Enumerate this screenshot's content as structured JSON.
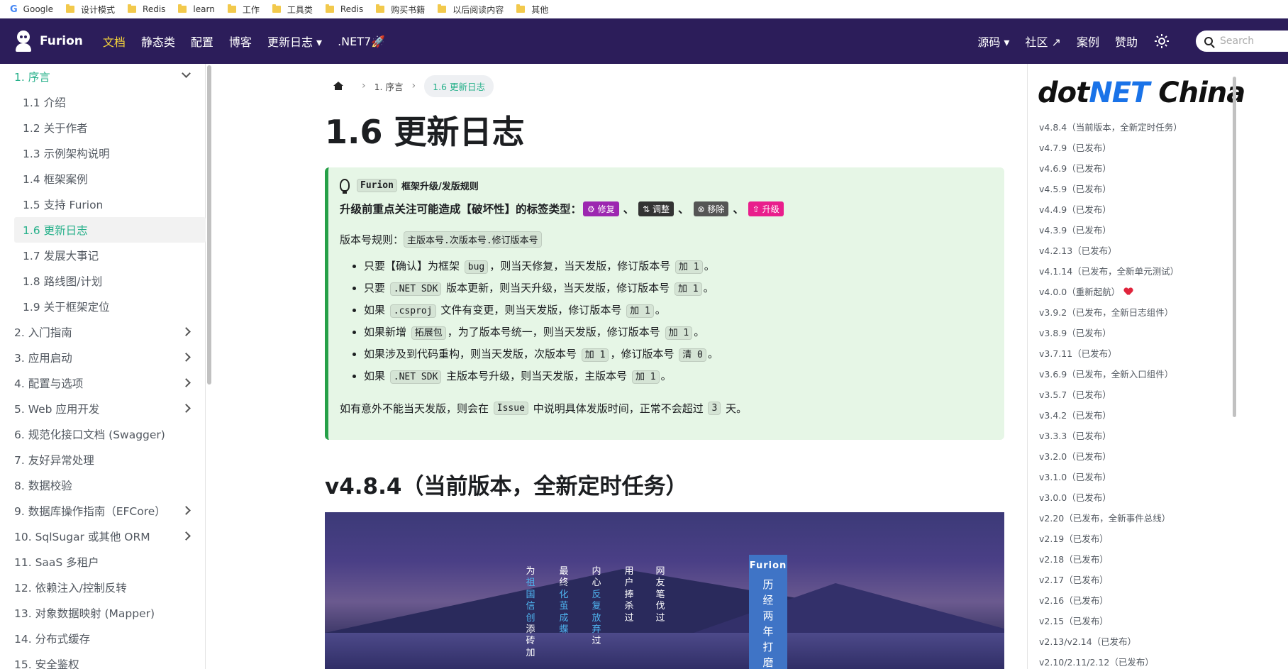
{
  "bookmarks": [
    {
      "label": "Google",
      "icon": "google-icon"
    },
    {
      "label": "设计模式",
      "icon": "folder-icon"
    },
    {
      "label": "Redis",
      "icon": "folder-icon"
    },
    {
      "label": "learn",
      "icon": "folder-icon"
    },
    {
      "label": "工作",
      "icon": "folder-icon"
    },
    {
      "label": "工具类",
      "icon": "folder-icon"
    },
    {
      "label": "Redis",
      "icon": "folder-icon"
    },
    {
      "label": "购买书籍",
      "icon": "folder-icon"
    },
    {
      "label": "以后阅读内容",
      "icon": "folder-icon"
    },
    {
      "label": "其他",
      "icon": "folder-icon"
    }
  ],
  "navbar": {
    "brand": "Furion",
    "items": [
      "文档",
      "静态类",
      "配置",
      "博客",
      "更新日志 ▾",
      ".NET7🚀"
    ],
    "active_item": "文档",
    "right_items": [
      "源码 ▾",
      "社区 ↗",
      "案例",
      "赞助"
    ],
    "search_placeholder": "Search"
  },
  "sidebar": {
    "items": [
      {
        "label": "1. 序言",
        "level": "top",
        "state": "cat-active",
        "chevron": "down"
      },
      {
        "label": "1.1 介绍",
        "level": "sub"
      },
      {
        "label": "1.2 关于作者",
        "level": "sub"
      },
      {
        "label": "1.3 示例架构说明",
        "level": "sub"
      },
      {
        "label": "1.4 框架案例",
        "level": "sub"
      },
      {
        "label": "1.5 支持 Furion",
        "level": "sub"
      },
      {
        "label": "1.6 更新日志",
        "level": "sub",
        "state": "active"
      },
      {
        "label": "1.7 发展大事记",
        "level": "sub"
      },
      {
        "label": "1.8 路线图/计划",
        "level": "sub"
      },
      {
        "label": "1.9 关于框架定位",
        "level": "sub"
      },
      {
        "label": "2. 入门指南",
        "level": "top",
        "chevron": "right"
      },
      {
        "label": "3. 应用启动",
        "level": "top",
        "chevron": "right"
      },
      {
        "label": "4. 配置与选项",
        "level": "top",
        "chevron": "right"
      },
      {
        "label": "5. Web 应用开发",
        "level": "top",
        "chevron": "right"
      },
      {
        "label": "6. 规范化接口文档 (Swagger)",
        "level": "top"
      },
      {
        "label": "7. 友好异常处理",
        "level": "top"
      },
      {
        "label": "8. 数据校验",
        "level": "top"
      },
      {
        "label": "9. 数据库操作指南（EFCore）",
        "level": "top",
        "chevron": "right"
      },
      {
        "label": "10. SqlSugar 或其他 ORM",
        "level": "top",
        "chevron": "right"
      },
      {
        "label": "11. SaaS 多租户",
        "level": "top"
      },
      {
        "label": "12. 依赖注入/控制反转",
        "level": "top"
      },
      {
        "label": "13. 对象数据映射 (Mapper)",
        "level": "top"
      },
      {
        "label": "14. 分布式缓存",
        "level": "top"
      },
      {
        "label": "15. 安全鉴权",
        "level": "top"
      }
    ]
  },
  "breadcrumb": {
    "items": [
      "1. 序言",
      "1.6 更新日志"
    ]
  },
  "page": {
    "title": "1.6 更新日志",
    "section_title": "v4.8.4（当前版本，全新定时任务）"
  },
  "tip": {
    "head_code": "Furion",
    "head_text": "框架升级/发版规则",
    "line1": "升级前重点关注可能造成【破坏性】的标签类型：",
    "tags": [
      {
        "label": "⚙ 修复",
        "color": "#9c27b0"
      },
      {
        "label": "⇅ 调整",
        "color": "#333333"
      },
      {
        "label": "⊗ 移除",
        "color": "#555555"
      },
      {
        "label": "⇧ 升级",
        "color": "#e91e8c"
      }
    ],
    "tag_separator": "、",
    "version_rule_label": "版本号规则：",
    "version_rule_code": "主版本号.次版本号.修订版本号",
    "list": [
      [
        {
          "t": "只要【确认】为框架 "
        },
        {
          "c": "bug"
        },
        {
          "t": "，则当天修复，当天发版，修订版本号 "
        },
        {
          "c": "加 1"
        },
        {
          "t": "。"
        }
      ],
      [
        {
          "t": "只要 "
        },
        {
          "c": ".NET SDK"
        },
        {
          "t": " 版本更新，则当天升级，当天发版，修订版本号 "
        },
        {
          "c": "加 1"
        },
        {
          "t": "。"
        }
      ],
      [
        {
          "t": "如果 "
        },
        {
          "c": ".csproj"
        },
        {
          "t": " 文件有变更，则当天发版，修订版本号 "
        },
        {
          "c": "加 1"
        },
        {
          "t": "。"
        }
      ],
      [
        {
          "t": "如果新增 "
        },
        {
          "c": "拓展包"
        },
        {
          "t": "，为了版本号统一，则当天发版，修订版本号 "
        },
        {
          "c": "加 1"
        },
        {
          "t": "。"
        }
      ],
      [
        {
          "t": "如果涉及到代码重构，则当天发版，次版本号 "
        },
        {
          "c": "加 1"
        },
        {
          "t": "，修订版本号 "
        },
        {
          "c": "清 0"
        },
        {
          "t": "。"
        }
      ],
      [
        {
          "t": "如果 "
        },
        {
          "c": ".NET SDK"
        },
        {
          "t": " 主版本号升级，则当天发版，主版本号 "
        },
        {
          "c": "加 1"
        },
        {
          "t": "。"
        }
      ]
    ],
    "end": [
      {
        "t": "如有意外不能当天发版，则会在 "
      },
      {
        "c": "Issue"
      },
      {
        "t": " 中说明具体发版时间，正常不会超过 "
      },
      {
        "c": "3"
      },
      {
        "t": " 天。"
      }
    ]
  },
  "banner": {
    "columns": [
      {
        "chars": [
          {
            "t": "为"
          },
          {
            "t": "祖国信创",
            "hl": true
          },
          {
            "t": "添砖加"
          }
        ]
      },
      {
        "chars": [
          {
            "t": "最终"
          },
          {
            "t": "化茧成蝶",
            "hl": true
          }
        ]
      },
      {
        "chars": [
          {
            "t": "内心"
          },
          {
            "t": "反复放弃",
            "hl": true
          },
          {
            "t": "过"
          }
        ]
      },
      {
        "chars": [
          {
            "t": "用户捧杀过"
          }
        ]
      },
      {
        "chars": [
          {
            "t": "网友笔伐过"
          }
        ]
      }
    ],
    "furion_title": "Furion",
    "furion_vertical": "历经两年打磨"
  },
  "toc": {
    "logo_prefix": "dot",
    "logo_net": "NET",
    "logo_suffix": " China",
    "items": [
      "v4.8.4（当前版本，全新定时任务）",
      "v4.7.9（已发布）",
      "v4.6.9（已发布）",
      "v4.5.9（已发布）",
      "v4.4.9（已发布）",
      "v4.3.9（已发布）",
      "v4.2.13（已发布）",
      "v4.1.14（已发布，全新单元测试）",
      "v4.0.0（重新起航）",
      "v3.9.2（已发布，全新日志组件）",
      "v3.8.9（已发布）",
      "v3.7.11（已发布）",
      "v3.6.9（已发布，全新入口组件）",
      "v3.5.7（已发布）",
      "v3.4.2（已发布）",
      "v3.3.3（已发布）",
      "v3.2.0（已发布）",
      "v3.1.0（已发布）",
      "v3.0.0（已发布）",
      "v2.20（已发布，全新事件总线）",
      "v2.19（已发布）",
      "v2.18（已发布）",
      "v2.17（已发布）",
      "v2.16（已发布）",
      "v2.15（已发布）",
      "v2.13/v2.14（已发布）",
      "v2.10/2.11/2.12（已发布）"
    ],
    "heart_item_index": 8
  }
}
